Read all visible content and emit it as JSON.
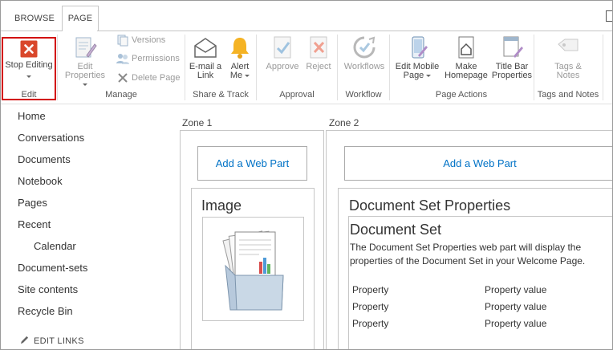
{
  "tabs": {
    "browse": "BROWSE",
    "page": "PAGE"
  },
  "ribbon": {
    "edit": {
      "stop_editing": "Stop Editing",
      "label": "Edit"
    },
    "manage": {
      "edit_properties_1": "Edit",
      "edit_properties_2": "Properties",
      "versions": "Versions",
      "permissions": "Permissions",
      "delete_page": "Delete Page",
      "label": "Manage"
    },
    "share": {
      "email_1": "E-mail a",
      "email_2": "Link",
      "alert_1": "Alert",
      "alert_2": "Me",
      "label": "Share & Track"
    },
    "approval": {
      "approve": "Approve",
      "reject": "Reject",
      "label": "Approval"
    },
    "workflow": {
      "workflows": "Workflows",
      "label": "Workflow"
    },
    "page_actions": {
      "edit_mobile_1": "Edit Mobile",
      "edit_mobile_2": "Page",
      "make_home_1": "Make",
      "make_home_2": "Homepage",
      "title_bar_1": "Title Bar",
      "title_bar_2": "Properties",
      "label": "Page Actions"
    },
    "tags": {
      "tags_1": "Tags &",
      "tags_2": "Notes",
      "label": "Tags and Notes"
    }
  },
  "nav": {
    "items": [
      "Home",
      "Conversations",
      "Documents",
      "Notebook",
      "Pages",
      "Recent",
      "Calendar",
      "Document-sets",
      "Site contents",
      "Recycle Bin"
    ],
    "edit_links": "EDIT LINKS"
  },
  "zones": {
    "zone1": {
      "title": "Zone 1",
      "add_web_part": "Add a Web Part",
      "image_title": "Image"
    },
    "zone2": {
      "title": "Zone 2",
      "add_web_part": "Add a Web Part",
      "wp_title": "Document Set Properties",
      "inner_title": "Document Set",
      "description": "The Document Set Properties web part will display the properties of the Document Set in your Welcome Page.",
      "rows": [
        {
          "property": "Property",
          "value": "Property value"
        },
        {
          "property": "Property",
          "value": "Property value"
        },
        {
          "property": "Property",
          "value": "Property value"
        }
      ]
    }
  },
  "colors": {
    "accent": "#0072c6",
    "highlight": "#d20000",
    "stop_icon": "#d9472b"
  }
}
